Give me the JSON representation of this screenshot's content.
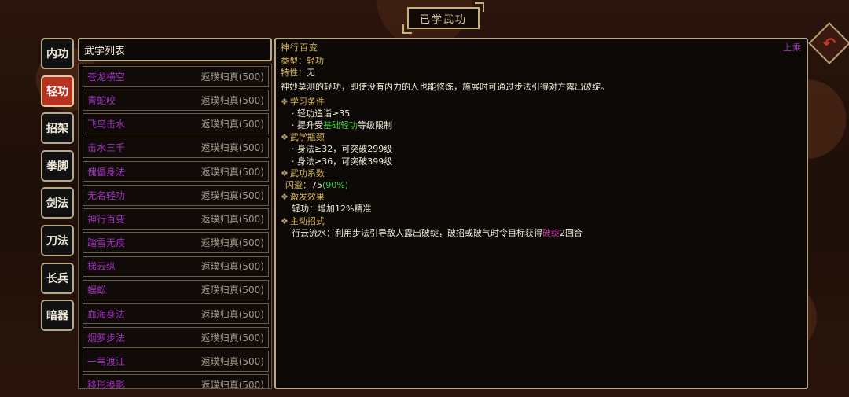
{
  "page_title": "已学武功",
  "back_icon": "return-arrow-icon",
  "tabs": [
    {
      "label": "内功",
      "active": false
    },
    {
      "label": "轻功",
      "active": true
    },
    {
      "label": "招架",
      "active": false
    },
    {
      "label": "拳脚",
      "active": false
    },
    {
      "label": "剑法",
      "active": false
    },
    {
      "label": "刀法",
      "active": false
    },
    {
      "label": "长兵",
      "active": false
    },
    {
      "label": "暗器",
      "active": false
    }
  ],
  "list": {
    "header": "武学列表",
    "items": [
      {
        "name": "苍龙横空",
        "rank": "返璞归真(500)"
      },
      {
        "name": "青蛇咬",
        "rank": "返璞归真(500)"
      },
      {
        "name": "飞鸟击水",
        "rank": "返璞归真(500)"
      },
      {
        "name": "击水三千",
        "rank": "返璞归真(500)"
      },
      {
        "name": "傀儡身法",
        "rank": "返璞归真(500)"
      },
      {
        "name": "无名轻功",
        "rank": "返璞归真(500)"
      },
      {
        "name": "神行百变",
        "rank": "返璞归真(500)"
      },
      {
        "name": "踏雪无痕",
        "rank": "返璞归真(500)"
      },
      {
        "name": "梯云纵",
        "rank": "返璞归真(500)"
      },
      {
        "name": "蜈蚣",
        "rank": "返璞归真(500)"
      },
      {
        "name": "血海身法",
        "rank": "返璞归真(500)"
      },
      {
        "name": "烟萝步法",
        "rank": "返璞归真(500)"
      },
      {
        "name": "一苇渡江",
        "rank": "返璞归真(500)"
      },
      {
        "name": "移形换影",
        "rank": "返璞归真(500)"
      }
    ]
  },
  "detail": {
    "name": "神行百变",
    "grade": "上乘",
    "type_label": "类型：",
    "type_value": "轻功",
    "trait_label": "特性：",
    "trait_value": "无",
    "description": "神妙莫测的轻功，即使没有内力的人也能修炼，施展时可通过步法引得对方露出破绽。",
    "sections": {
      "learn": {
        "title": "学习条件",
        "line1": "· 轻功造诣≥35",
        "line2_pre": "· 提升受",
        "line2_hl": "基础轻功",
        "line2_post": "等级限制"
      },
      "bottleneck": {
        "title": "武学瓶颈",
        "line1": "· 身法≥32，可突破299级",
        "line2": "· 身法≥36，可突破399级"
      },
      "coef": {
        "title": "武功系数",
        "label": "闪避：",
        "value": "75",
        "percent": "(90%)"
      },
      "effect": {
        "title": "激发效果",
        "text": "轻功：增加12%精准"
      },
      "move": {
        "title": "主动招式",
        "pre": "行云流水：利用步法引导敌人露出破绽，破招或破气时令目标获得",
        "hl": "破绽",
        "post": "2回合"
      }
    }
  },
  "colors": {
    "active_tab": "#b53120",
    "list_name": "#a030c0",
    "gold": "#d8b65a",
    "green": "#3ed13e",
    "magenta": "#d233a8"
  }
}
